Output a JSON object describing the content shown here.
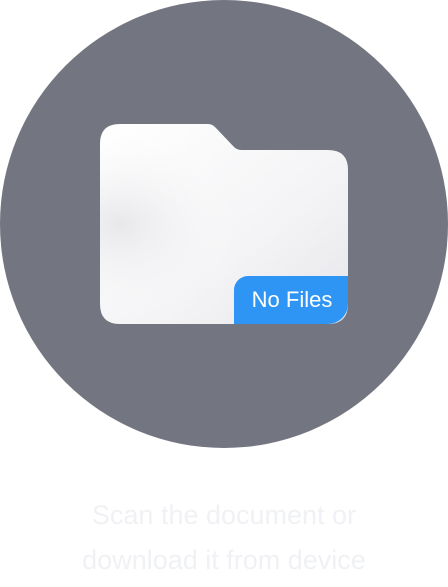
{
  "empty_state": {
    "badge_label": "No Files",
    "hint_lines": [
      "Scan the document or",
      "download it from device"
    ],
    "icon": "folder-icon"
  },
  "colors": {
    "circle": "#737680",
    "badge": "#2f95f5",
    "folder": "#f4f4f6",
    "hint_text": "#f0f1f4"
  }
}
